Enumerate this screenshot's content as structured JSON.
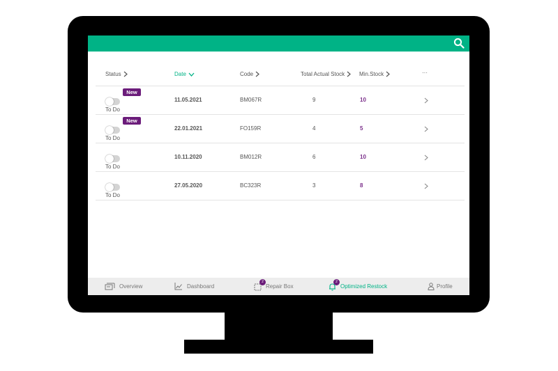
{
  "colors": {
    "brand": "#00b386",
    "accent_purple": "#7b2f8a",
    "badge_purple": "#6b1c7a",
    "nav_background": "#ededed"
  },
  "header": {
    "search_icon": "search-icon"
  },
  "table": {
    "columns": [
      {
        "key": "status",
        "label": "Status",
        "sorted": false,
        "icon": "chevron-right-icon"
      },
      {
        "key": "date",
        "label": "Date",
        "sorted": true,
        "icon": "chevron-down-icon"
      },
      {
        "key": "code",
        "label": "Code",
        "sorted": false,
        "icon": "chevron-right-icon"
      },
      {
        "key": "total",
        "label": "Total Actual Stock",
        "sorted": false,
        "icon": "chevron-right-icon"
      },
      {
        "key": "min",
        "label": "Min.Stock",
        "sorted": false,
        "icon": "chevron-right-icon"
      },
      {
        "key": "more",
        "label": "···",
        "sorted": false,
        "icon": "more-icon"
      }
    ],
    "rows": [
      {
        "badge": "New",
        "status": "To Do",
        "date": "11.05.2021",
        "code": "BM067R",
        "total": "9",
        "min": "10"
      },
      {
        "badge": "New",
        "status": "To Do",
        "date": "22.01.2021",
        "code": "FO159R",
        "total": "4",
        "min": "5"
      },
      {
        "badge": "",
        "status": "To Do",
        "date": "10.11.2020",
        "code": "BM012R",
        "total": "6",
        "min": "10"
      },
      {
        "badge": "",
        "status": "To Do",
        "date": "27.05.2020",
        "code": "BC323R",
        "total": "3",
        "min": "8"
      }
    ]
  },
  "bottom_nav": {
    "items": [
      {
        "label": "Overview",
        "icon": "overview-icon",
        "active": false,
        "badge": ""
      },
      {
        "label": "Dashboard",
        "icon": "chart-icon",
        "active": false,
        "badge": ""
      },
      {
        "label": "Repair Box",
        "icon": "repair-box-icon",
        "active": false,
        "badge": "2"
      },
      {
        "label": "Optimized Restock",
        "icon": "bell-icon",
        "active": true,
        "badge": "2"
      },
      {
        "label": "Profile",
        "icon": "user-icon",
        "active": false,
        "badge": ""
      }
    ]
  }
}
